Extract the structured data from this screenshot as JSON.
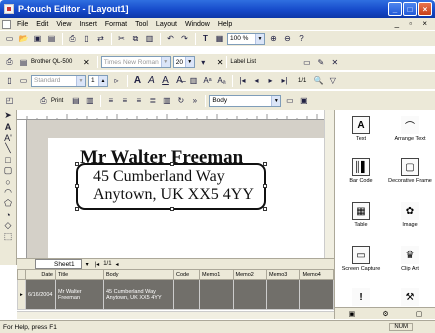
{
  "window": {
    "title": "P-touch Editor - [Layout1]"
  },
  "menu": [
    "File",
    "Edit",
    "View",
    "Insert",
    "Format",
    "Tool",
    "Layout",
    "Window",
    "Help"
  ],
  "toolbar_row1": {
    "zoom": "100 %"
  },
  "toolbar_row2": {
    "printer": "Brother QL-500",
    "paper": "Standard",
    "print_label": "Print",
    "copies": "1",
    "font": "Times New Roman",
    "font_size": "20",
    "panel": "Label List",
    "page_count": "1/1"
  },
  "toolbar_row3": {
    "style": "Body"
  },
  "label": {
    "name": "Mr Walter Freeman",
    "address_line1": "45 Cumberland Way",
    "address_line2": "Anytown, UK XX5 4YY"
  },
  "sheet": {
    "tab": "Sheet1",
    "pager": "1/1"
  },
  "grid": {
    "headers": [
      "",
      "Date",
      "Title",
      "Body",
      "Code",
      "Memo1",
      "Memo2",
      "Memo3",
      "Memo4"
    ],
    "rows": [
      {
        "date": "6/16/2004",
        "title": "Mr Walter Freeman",
        "body": "45 Cumberland Way Anytown, UK XX5 4YY",
        "code": "",
        "memo1": "",
        "memo2": "",
        "memo3": "",
        "memo4": ""
      }
    ]
  },
  "tools": [
    {
      "label": "Text",
      "icon": "text-icon"
    },
    {
      "label": "Arrange Text",
      "icon": "arrange-text-icon"
    },
    {
      "label": "Bar Code",
      "icon": "barcode-icon"
    },
    {
      "label": "Decorative Frame",
      "icon": "frame-icon"
    },
    {
      "label": "Table",
      "icon": "table-icon"
    },
    {
      "label": "Image",
      "icon": "image-icon"
    },
    {
      "label": "Screen Capture",
      "icon": "screen-capture-icon"
    },
    {
      "label": "Clip Art",
      "icon": "clipart-icon"
    }
  ],
  "status": {
    "text": "For Help, press F1",
    "num": "NUM"
  }
}
